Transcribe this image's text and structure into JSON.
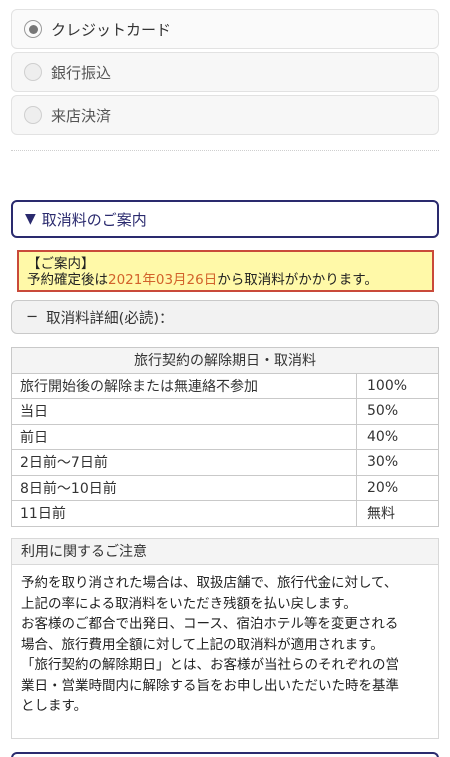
{
  "payment": {
    "options": [
      {
        "label": "クレジットカード",
        "selected": true
      },
      {
        "label": "銀行振込",
        "selected": false
      },
      {
        "label": "来店決済",
        "selected": false
      }
    ]
  },
  "cancel_section": {
    "header_icon": "▼",
    "header_label": "取消料のご案内",
    "notice_title": "【ご案内】",
    "notice_prefix": "予約確定後は",
    "notice_date": "2021年03月26日",
    "notice_suffix": "から取消料がかかります。",
    "detail_toggle_icon": "−",
    "detail_toggle_label": "取消料詳細(必読)：",
    "table_header": "旅行契約の解除期日・取消料",
    "rows": [
      {
        "period": "旅行開始後の解除または無連絡不参加",
        "rate": "100%"
      },
      {
        "period": "当日",
        "rate": "50%"
      },
      {
        "period": "前日",
        "rate": "40%"
      },
      {
        "period": "2日前〜7日前",
        "rate": "30%"
      },
      {
        "period": "8日前〜10日前",
        "rate": "20%"
      },
      {
        "period": "11日前",
        "rate": "無料"
      }
    ]
  },
  "notes": {
    "title": "利用に関するご注意",
    "lines": [
      "予約を取り消された場合は、取扱店舗で、旅行代金に対して、",
      "上記の率による取消料をいただき残額を払い戻します。",
      "お客様のご都合で出発日、コース、宿泊ホテル等を変更される",
      "場合、旅行費用全額に対して上記の取消料が適用されます。",
      "「旅行契約の解除期日」とは、お客様が当社らのそれぞれの営",
      "業日・営業時間内に解除する旨をお申し出いただいた時を基準",
      "とします。"
    ]
  },
  "colors": {
    "header_border": "#2a2a6e",
    "notice_border": "#c94a3a",
    "notice_bg": "#fff9a8",
    "notice_date": "#d2622b"
  }
}
